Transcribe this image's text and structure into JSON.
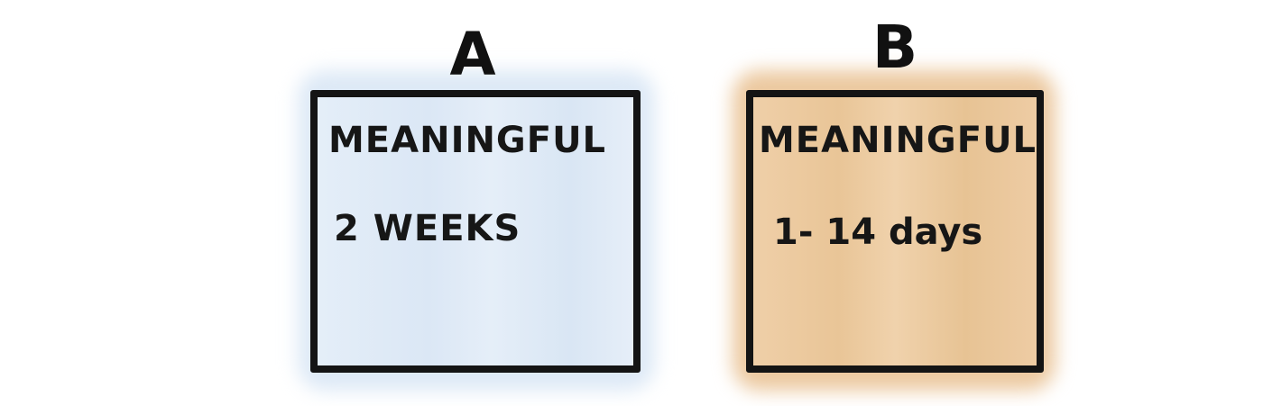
{
  "options": [
    {
      "letter": "A",
      "title": "MEANINGFUL",
      "value": "2 WEEKS",
      "color": "#dde9f6"
    },
    {
      "letter": "B",
      "title": "MEANINGFUL",
      "value": "1- 14 days",
      "color": "#ecc9a0"
    }
  ],
  "border_color": "#141414"
}
